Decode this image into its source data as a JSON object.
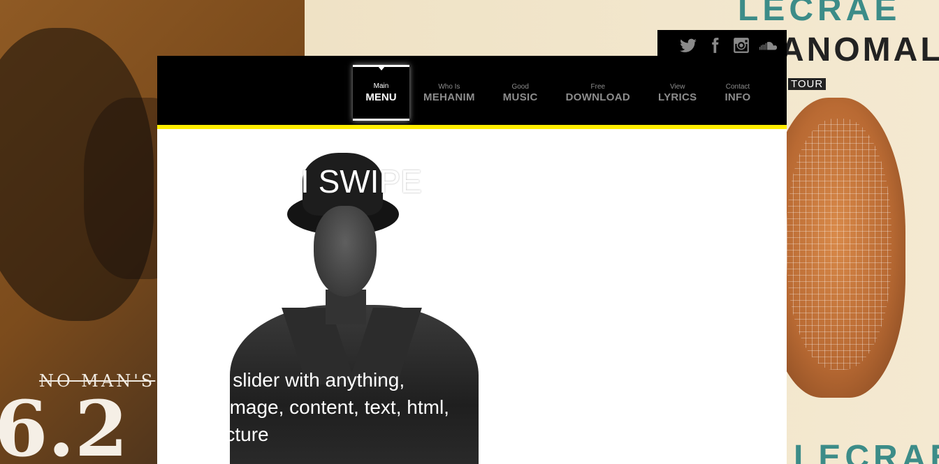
{
  "background": {
    "left_album": {
      "line1": "NO MAN'S",
      "line2": "6.2"
    },
    "right_album": {
      "artist_top": "LECRAE",
      "album": "ANOMALY",
      "tour": "TOUR",
      "artist_bottom": "LECRAE"
    }
  },
  "social": {
    "icons": [
      "twitter-icon",
      "facebook-icon",
      "instagram-icon",
      "soundcloud-icon"
    ]
  },
  "nav": {
    "menu": {
      "small": "Main",
      "big": "MENU"
    },
    "items": [
      {
        "small": "Who Is",
        "big": "MEHANIM"
      },
      {
        "small": "Good",
        "big": "MUSIC"
      },
      {
        "small": "Free",
        "big": "DOWNLOAD"
      },
      {
        "small": "View",
        "big": "LYRICS"
      },
      {
        "small": "Contact",
        "big": "INFO"
      }
    ]
  },
  "slide": {
    "title": "SWIPE",
    "title_prefix": "I",
    "question": "?",
    "lines": [
      "our slider with anything,",
      "es image, content, text, html,",
      ", picture"
    ]
  },
  "colors": {
    "accent": "#ffee00",
    "nav_bg": "#000000",
    "nav_text": "#8c8c8c"
  }
}
